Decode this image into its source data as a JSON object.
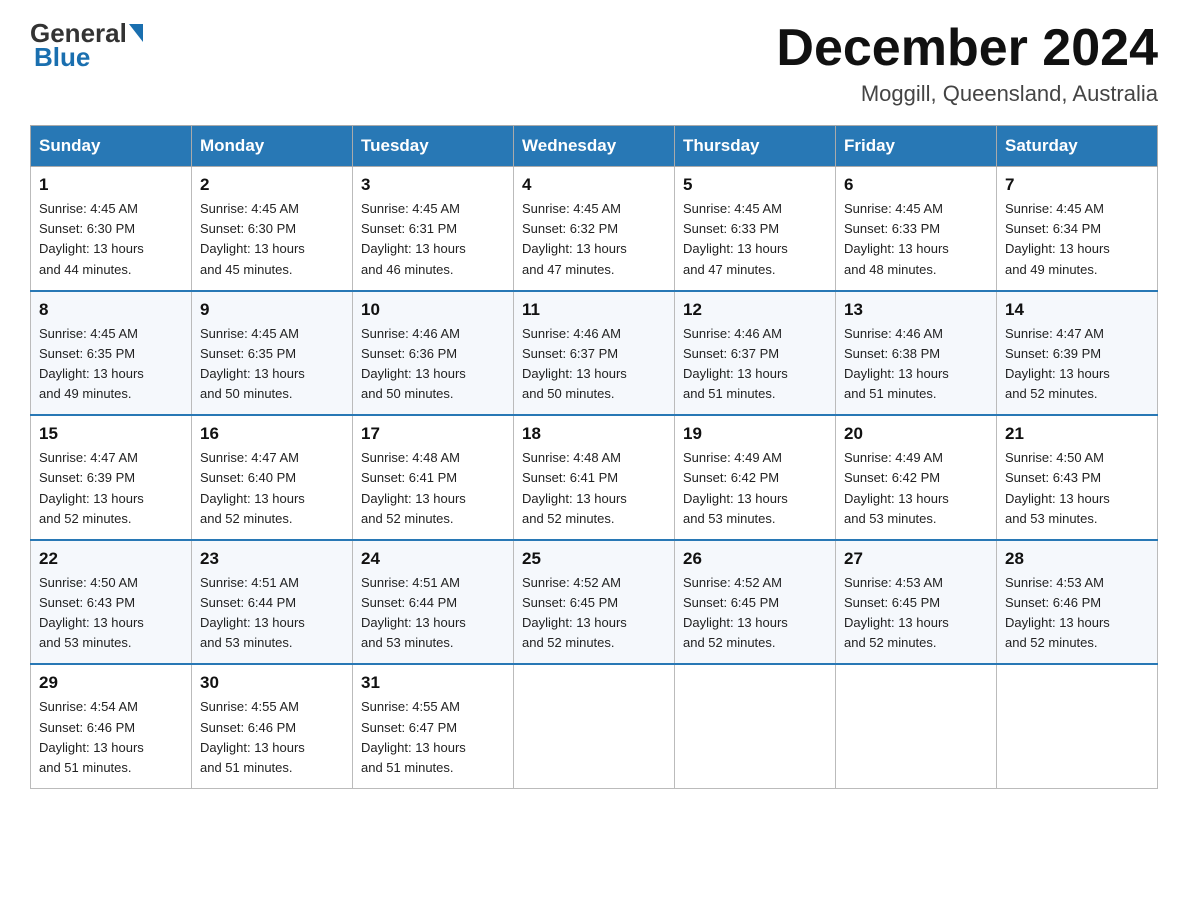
{
  "header": {
    "logo_general": "General",
    "logo_blue": "Blue",
    "month_year": "December 2024",
    "location": "Moggill, Queensland, Australia"
  },
  "days_of_week": [
    "Sunday",
    "Monday",
    "Tuesday",
    "Wednesday",
    "Thursday",
    "Friday",
    "Saturday"
  ],
  "weeks": [
    [
      {
        "day": "1",
        "sunrise": "4:45 AM",
        "sunset": "6:30 PM",
        "daylight": "13 hours and 44 minutes."
      },
      {
        "day": "2",
        "sunrise": "4:45 AM",
        "sunset": "6:30 PM",
        "daylight": "13 hours and 45 minutes."
      },
      {
        "day": "3",
        "sunrise": "4:45 AM",
        "sunset": "6:31 PM",
        "daylight": "13 hours and 46 minutes."
      },
      {
        "day": "4",
        "sunrise": "4:45 AM",
        "sunset": "6:32 PM",
        "daylight": "13 hours and 47 minutes."
      },
      {
        "day": "5",
        "sunrise": "4:45 AM",
        "sunset": "6:33 PM",
        "daylight": "13 hours and 47 minutes."
      },
      {
        "day": "6",
        "sunrise": "4:45 AM",
        "sunset": "6:33 PM",
        "daylight": "13 hours and 48 minutes."
      },
      {
        "day": "7",
        "sunrise": "4:45 AM",
        "sunset": "6:34 PM",
        "daylight": "13 hours and 49 minutes."
      }
    ],
    [
      {
        "day": "8",
        "sunrise": "4:45 AM",
        "sunset": "6:35 PM",
        "daylight": "13 hours and 49 minutes."
      },
      {
        "day": "9",
        "sunrise": "4:45 AM",
        "sunset": "6:35 PM",
        "daylight": "13 hours and 50 minutes."
      },
      {
        "day": "10",
        "sunrise": "4:46 AM",
        "sunset": "6:36 PM",
        "daylight": "13 hours and 50 minutes."
      },
      {
        "day": "11",
        "sunrise": "4:46 AM",
        "sunset": "6:37 PM",
        "daylight": "13 hours and 50 minutes."
      },
      {
        "day": "12",
        "sunrise": "4:46 AM",
        "sunset": "6:37 PM",
        "daylight": "13 hours and 51 minutes."
      },
      {
        "day": "13",
        "sunrise": "4:46 AM",
        "sunset": "6:38 PM",
        "daylight": "13 hours and 51 minutes."
      },
      {
        "day": "14",
        "sunrise": "4:47 AM",
        "sunset": "6:39 PM",
        "daylight": "13 hours and 52 minutes."
      }
    ],
    [
      {
        "day": "15",
        "sunrise": "4:47 AM",
        "sunset": "6:39 PM",
        "daylight": "13 hours and 52 minutes."
      },
      {
        "day": "16",
        "sunrise": "4:47 AM",
        "sunset": "6:40 PM",
        "daylight": "13 hours and 52 minutes."
      },
      {
        "day": "17",
        "sunrise": "4:48 AM",
        "sunset": "6:41 PM",
        "daylight": "13 hours and 52 minutes."
      },
      {
        "day": "18",
        "sunrise": "4:48 AM",
        "sunset": "6:41 PM",
        "daylight": "13 hours and 52 minutes."
      },
      {
        "day": "19",
        "sunrise": "4:49 AM",
        "sunset": "6:42 PM",
        "daylight": "13 hours and 53 minutes."
      },
      {
        "day": "20",
        "sunrise": "4:49 AM",
        "sunset": "6:42 PM",
        "daylight": "13 hours and 53 minutes."
      },
      {
        "day": "21",
        "sunrise": "4:50 AM",
        "sunset": "6:43 PM",
        "daylight": "13 hours and 53 minutes."
      }
    ],
    [
      {
        "day": "22",
        "sunrise": "4:50 AM",
        "sunset": "6:43 PM",
        "daylight": "13 hours and 53 minutes."
      },
      {
        "day": "23",
        "sunrise": "4:51 AM",
        "sunset": "6:44 PM",
        "daylight": "13 hours and 53 minutes."
      },
      {
        "day": "24",
        "sunrise": "4:51 AM",
        "sunset": "6:44 PM",
        "daylight": "13 hours and 53 minutes."
      },
      {
        "day": "25",
        "sunrise": "4:52 AM",
        "sunset": "6:45 PM",
        "daylight": "13 hours and 52 minutes."
      },
      {
        "day": "26",
        "sunrise": "4:52 AM",
        "sunset": "6:45 PM",
        "daylight": "13 hours and 52 minutes."
      },
      {
        "day": "27",
        "sunrise": "4:53 AM",
        "sunset": "6:45 PM",
        "daylight": "13 hours and 52 minutes."
      },
      {
        "day": "28",
        "sunrise": "4:53 AM",
        "sunset": "6:46 PM",
        "daylight": "13 hours and 52 minutes."
      }
    ],
    [
      {
        "day": "29",
        "sunrise": "4:54 AM",
        "sunset": "6:46 PM",
        "daylight": "13 hours and 51 minutes."
      },
      {
        "day": "30",
        "sunrise": "4:55 AM",
        "sunset": "6:46 PM",
        "daylight": "13 hours and 51 minutes."
      },
      {
        "day": "31",
        "sunrise": "4:55 AM",
        "sunset": "6:47 PM",
        "daylight": "13 hours and 51 minutes."
      },
      null,
      null,
      null,
      null
    ]
  ],
  "labels": {
    "sunrise": "Sunrise:",
    "sunset": "Sunset:",
    "daylight": "Daylight:"
  }
}
